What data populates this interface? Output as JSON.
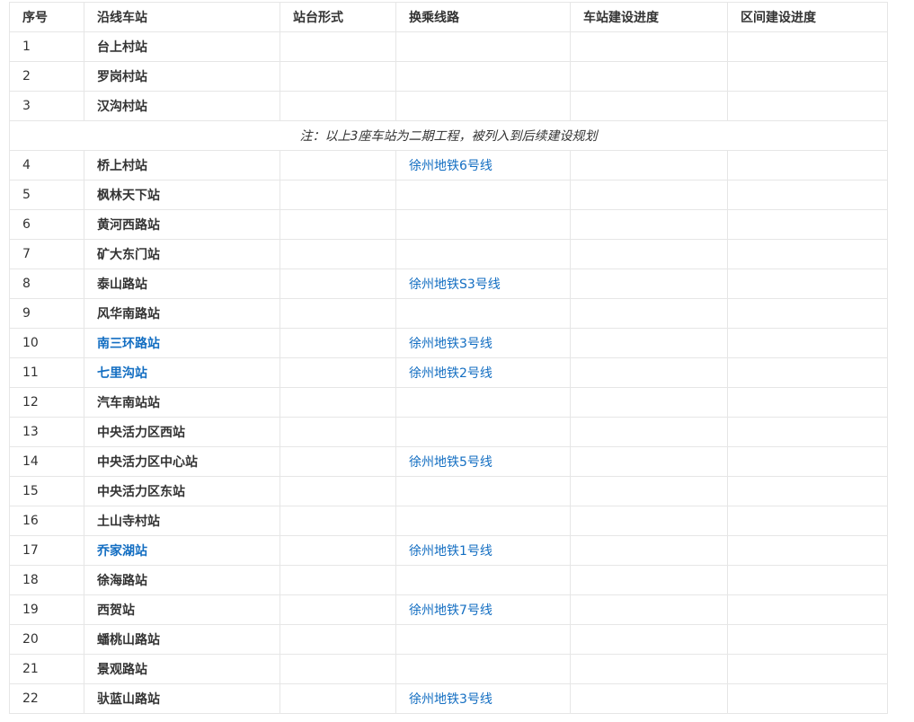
{
  "headers": [
    "序号",
    "沿线车站",
    "站台形式",
    "换乘线路",
    "车站建设进度",
    "区间建设进度"
  ],
  "rows_before_note": [
    {
      "no": "1",
      "station": "台上村站",
      "station_link": false,
      "transfer": ""
    },
    {
      "no": "2",
      "station": "罗岗村站",
      "station_link": false,
      "transfer": ""
    },
    {
      "no": "3",
      "station": "汉沟村站",
      "station_link": false,
      "transfer": ""
    }
  ],
  "note": "注：以上3座车站为二期工程，被列入到后续建设规划",
  "rows_after_note": [
    {
      "no": "4",
      "station": "桥上村站",
      "station_link": false,
      "transfer": "徐州地铁6号线"
    },
    {
      "no": "5",
      "station": "枫林天下站",
      "station_link": false,
      "transfer": ""
    },
    {
      "no": "6",
      "station": "黄河西路站",
      "station_link": false,
      "transfer": ""
    },
    {
      "no": "7",
      "station": "矿大东门站",
      "station_link": false,
      "transfer": ""
    },
    {
      "no": "8",
      "station": "泰山路站",
      "station_link": false,
      "transfer": "徐州地铁S3号线"
    },
    {
      "no": "9",
      "station": "风华南路站",
      "station_link": false,
      "transfer": ""
    },
    {
      "no": "10",
      "station": "南三环路站",
      "station_link": true,
      "transfer": "徐州地铁3号线"
    },
    {
      "no": "11",
      "station": "七里沟站",
      "station_link": true,
      "transfer": "徐州地铁2号线"
    },
    {
      "no": "12",
      "station": "汽车南站站",
      "station_link": false,
      "transfer": ""
    },
    {
      "no": "13",
      "station": "中央活力区西站",
      "station_link": false,
      "transfer": ""
    },
    {
      "no": "14",
      "station": "中央活力区中心站",
      "station_link": false,
      "transfer": "徐州地铁5号线"
    },
    {
      "no": "15",
      "station": "中央活力区东站",
      "station_link": false,
      "transfer": ""
    },
    {
      "no": "16",
      "station": "土山寺村站",
      "station_link": false,
      "transfer": ""
    },
    {
      "no": "17",
      "station": "乔家湖站",
      "station_link": true,
      "transfer": "徐州地铁1号线"
    },
    {
      "no": "18",
      "station": "徐海路站",
      "station_link": false,
      "transfer": ""
    },
    {
      "no": "19",
      "station": "西贺站",
      "station_link": false,
      "transfer": "徐州地铁7号线"
    },
    {
      "no": "20",
      "station": "蟠桃山路站",
      "station_link": false,
      "transfer": ""
    },
    {
      "no": "21",
      "station": "景观路站",
      "station_link": false,
      "transfer": ""
    },
    {
      "no": "22",
      "station": "驮蓝山路站",
      "station_link": false,
      "transfer": "徐州地铁3号线"
    }
  ]
}
